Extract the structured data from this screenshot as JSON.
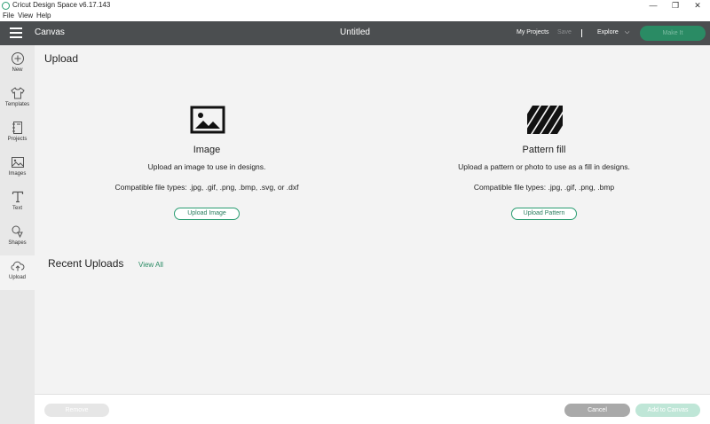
{
  "window": {
    "title": "Cricut Design Space  v6.17.143",
    "minimize_glyph": "—",
    "maximize_glyph": "❐",
    "close_glyph": "✕"
  },
  "menu": {
    "items": [
      "File",
      "View",
      "Help"
    ]
  },
  "header": {
    "section": "Canvas",
    "project_title": "Untitled",
    "my_projects": "My Projects",
    "save": "Save",
    "divider": "|",
    "explore": "Explore",
    "make_it": "Make It",
    "colors": {
      "header_bg": "#4b4e50",
      "accent": "#2a8b64"
    }
  },
  "sidebar": {
    "items": [
      {
        "label": "New",
        "icon": "plus-circle-icon"
      },
      {
        "label": "Templates",
        "icon": "tshirt-icon"
      },
      {
        "label": "Projects",
        "icon": "notebook-icon"
      },
      {
        "label": "Images",
        "icon": "image-icon"
      },
      {
        "label": "Text",
        "icon": "text-icon"
      },
      {
        "label": "Shapes",
        "icon": "shapes-icon"
      },
      {
        "label": "Upload",
        "icon": "cloud-upload-icon",
        "active": true
      }
    ]
  },
  "main": {
    "title": "Upload",
    "image": {
      "heading": "Image",
      "description": "Upload an image to use in designs.",
      "types": "Compatible file types: .jpg, .gif, .png, .bmp, .svg, or .dxf",
      "button": "Upload Image",
      "icon": "image-icon"
    },
    "pattern": {
      "heading": "Pattern fill",
      "description": "Upload a pattern or photo to use as a fill in designs.",
      "types": "Compatible file types: .jpg, .gif, .png, .bmp",
      "button": "Upload Pattern",
      "icon": "striped-pattern-icon"
    },
    "recent": {
      "title": "Recent Uploads",
      "view_all": "View All"
    }
  },
  "footer": {
    "remove": "Remove",
    "cancel": "Cancel",
    "add_to_canvas": "Add to Canvas"
  }
}
